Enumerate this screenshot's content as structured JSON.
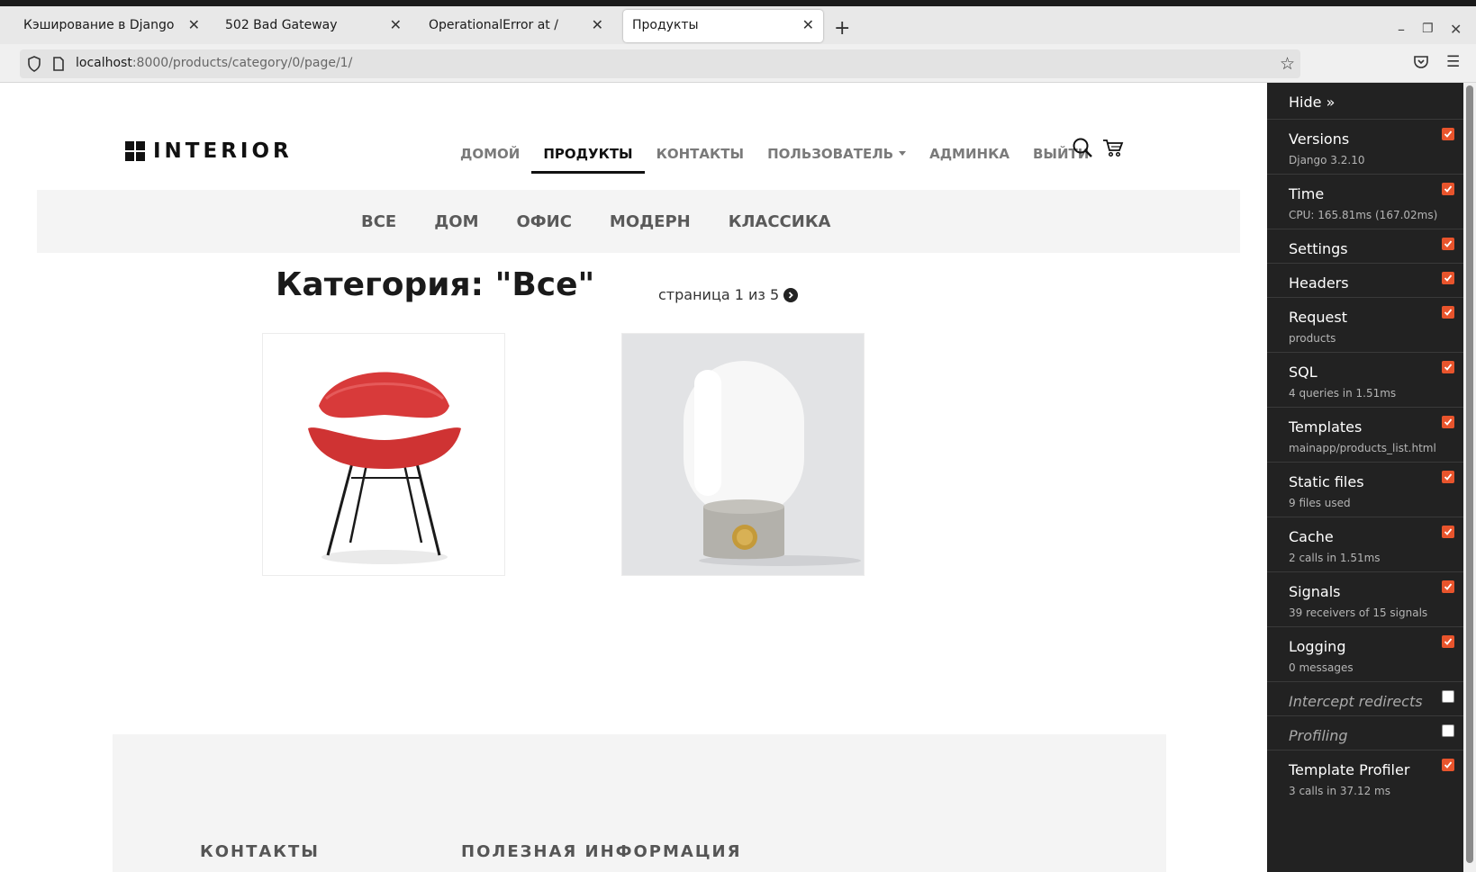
{
  "browser": {
    "tabs": [
      {
        "label": "Кэширование в Django"
      },
      {
        "label": "502 Bad Gateway"
      },
      {
        "label": "OperationalError at /"
      },
      {
        "label": "Продукты"
      }
    ],
    "active_tab_index": 3,
    "url_host": "localhost",
    "url_rest": ":8000/products/category/0/page/1/"
  },
  "site": {
    "logo_text": "INTERIOR",
    "nav": [
      {
        "label": "ДОМОЙ"
      },
      {
        "label": "ПРОДУКТЫ"
      },
      {
        "label": "КОНТАКТЫ"
      },
      {
        "label": "ПОЛЬЗОВАТЕЛЬ"
      },
      {
        "label": "АДМИНКА"
      },
      {
        "label": "ВЫЙТИ"
      }
    ],
    "active_nav_index": 1,
    "categories": [
      {
        "label": "ВСЕ"
      },
      {
        "label": "ДОМ"
      },
      {
        "label": "ОФИС"
      },
      {
        "label": "МОДЕРН"
      },
      {
        "label": "КЛАССИКА"
      }
    ],
    "category_title": "Категория: \"Все\"",
    "pager_text": "страница 1 из 5",
    "products": [
      {
        "kind": "red chair"
      },
      {
        "kind": "white lamp"
      }
    ],
    "footer": {
      "contacts_heading": "КОНТАКТЫ",
      "info_heading": "ПОЛЕЗНАЯ ИНФОРМАЦИЯ"
    }
  },
  "debug_toolbar": {
    "hide_label": "Hide »",
    "panels": [
      {
        "title": "Versions",
        "subtitle": "Django 3.2.10",
        "enabled": true
      },
      {
        "title": "Time",
        "subtitle": "CPU: 165.81ms (167.02ms)",
        "enabled": true
      },
      {
        "title": "Settings",
        "subtitle": "",
        "enabled": true
      },
      {
        "title": "Headers",
        "subtitle": "",
        "enabled": true
      },
      {
        "title": "Request",
        "subtitle": "products",
        "enabled": true
      },
      {
        "title": "SQL",
        "subtitle": "4 queries in 1.51ms",
        "enabled": true
      },
      {
        "title": "Templates",
        "subtitle": "mainapp/products_list.html",
        "enabled": true
      },
      {
        "title": "Static files",
        "subtitle": "9 files used",
        "enabled": true
      },
      {
        "title": "Cache",
        "subtitle": "2 calls in 1.51ms",
        "enabled": true
      },
      {
        "title": "Signals",
        "subtitle": "39 receivers of 15 signals",
        "enabled": true
      },
      {
        "title": "Logging",
        "subtitle": "0 messages",
        "enabled": true
      },
      {
        "title": "Intercept redirects",
        "subtitle": "",
        "enabled": false
      },
      {
        "title": "Profiling",
        "subtitle": "",
        "enabled": false
      },
      {
        "title": "Template Profiler",
        "subtitle": "3 calls in 37.12 ms",
        "enabled": true
      }
    ],
    "accent_color": "#e8542c"
  }
}
